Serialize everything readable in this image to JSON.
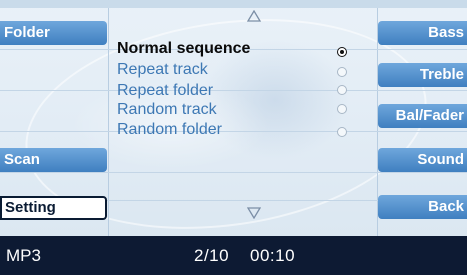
{
  "left_buttons": {
    "folder": "Folder",
    "scan": "Scan",
    "setting": "Setting"
  },
  "right_buttons": {
    "bass": "Bass",
    "treble": "Treble",
    "balance_fader": "Bal/Fader",
    "sound": "Sound",
    "back": "Back"
  },
  "scroll": {
    "up_icon": "triangle-up",
    "down_icon": "triangle-down"
  },
  "playback_modes": [
    {
      "label": "Normal sequence",
      "selected": true
    },
    {
      "label": "Repeat track",
      "selected": false
    },
    {
      "label": "Repeat folder",
      "selected": false
    },
    {
      "label": "Random track",
      "selected": false
    },
    {
      "label": "Random folder",
      "selected": false
    }
  ],
  "status_bar": {
    "source": "MP3",
    "track": "2/10",
    "time": "00:10"
  },
  "colors": {
    "button_blue": "#4f8fce",
    "selected_text": "#0a0a0a",
    "unselected_text": "#3d78b4",
    "status_bar_bg": "#0d1a33",
    "screen_bg": "#e4edf6"
  }
}
